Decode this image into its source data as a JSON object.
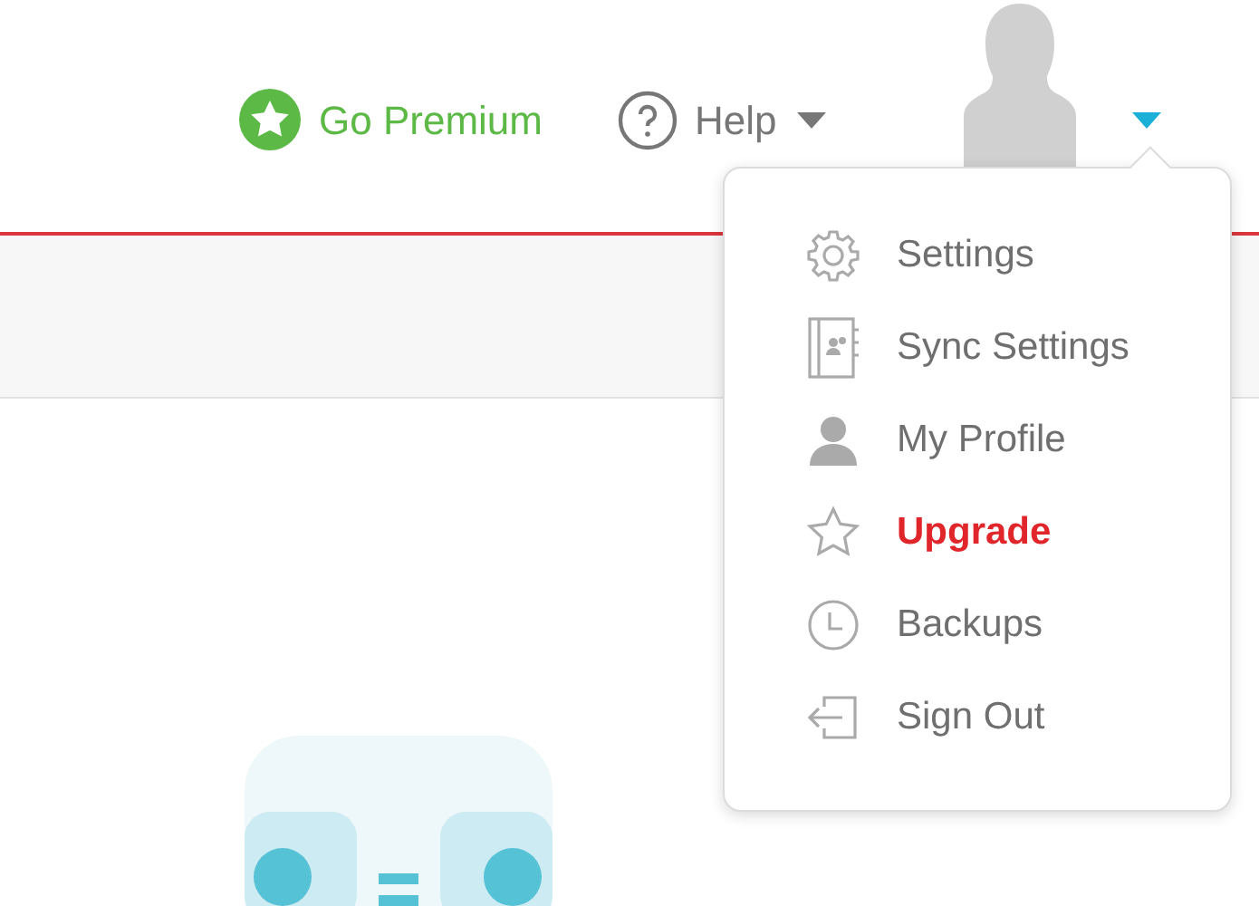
{
  "header": {
    "premium_link": "Go Premium",
    "help_menu": {
      "label": "Help",
      "expanded": false
    },
    "account_menu": {
      "expanded": true
    }
  },
  "account_menu": {
    "items": [
      {
        "kind": "settings",
        "label": "Settings",
        "highlighted": false
      },
      {
        "kind": "sync",
        "label": "Sync Settings",
        "highlighted": false
      },
      {
        "kind": "profile",
        "label": "My Profile",
        "highlighted": false
      },
      {
        "kind": "upgrade",
        "label": "Upgrade",
        "highlighted": true
      },
      {
        "kind": "backups",
        "label": "Backups",
        "highlighted": false
      },
      {
        "kind": "signout",
        "label": "Sign Out",
        "highlighted": false
      }
    ]
  }
}
